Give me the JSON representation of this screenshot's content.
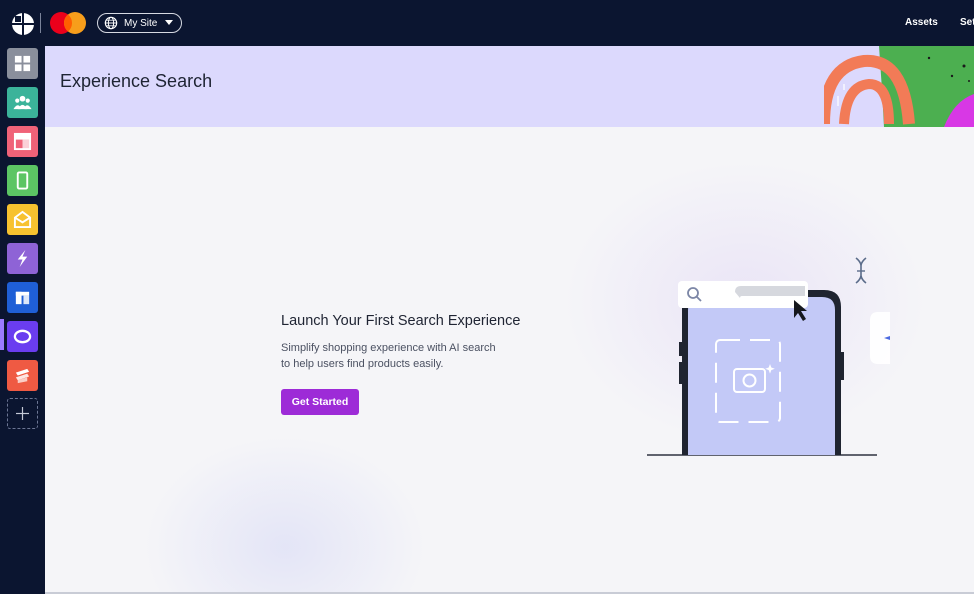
{
  "topbar": {
    "site_selector": {
      "label": "My Site"
    },
    "nav": [
      {
        "label": "Assets"
      },
      {
        "label": "Set"
      }
    ]
  },
  "sidebar": {
    "items": [
      {
        "icon": "dashboard-grid-icon",
        "color": "#8a8f9c"
      },
      {
        "icon": "people-group-icon",
        "color": "#3bb39a"
      },
      {
        "icon": "layout-icon",
        "color": "#f06278"
      },
      {
        "icon": "mobile-phone-icon",
        "color": "#5cc564"
      },
      {
        "icon": "envelope-icon",
        "color": "#f7c22f"
      },
      {
        "icon": "lightning-icon",
        "color": "#8e63d6"
      },
      {
        "icon": "blocks-icon",
        "color": "#1f5fd6"
      },
      {
        "icon": "experience-search-icon",
        "color": "#6a3df0",
        "active": true
      },
      {
        "icon": "layers-s-icon",
        "color": "#ef5a43"
      }
    ],
    "add_icon": "plus-icon"
  },
  "header": {
    "title": "Experience Search"
  },
  "empty_state": {
    "title": "Launch Your First Search Experience",
    "description_lines": [
      "Simplify shopping experience with AI search",
      "to help users find products easily."
    ],
    "cta_label": "Get Started"
  },
  "colors": {
    "topbar_bg": "#0b1530",
    "header_bg": "#dcd9fd",
    "cta_bg": "#9d2bd7",
    "page_bg": "#f5f5f8"
  }
}
